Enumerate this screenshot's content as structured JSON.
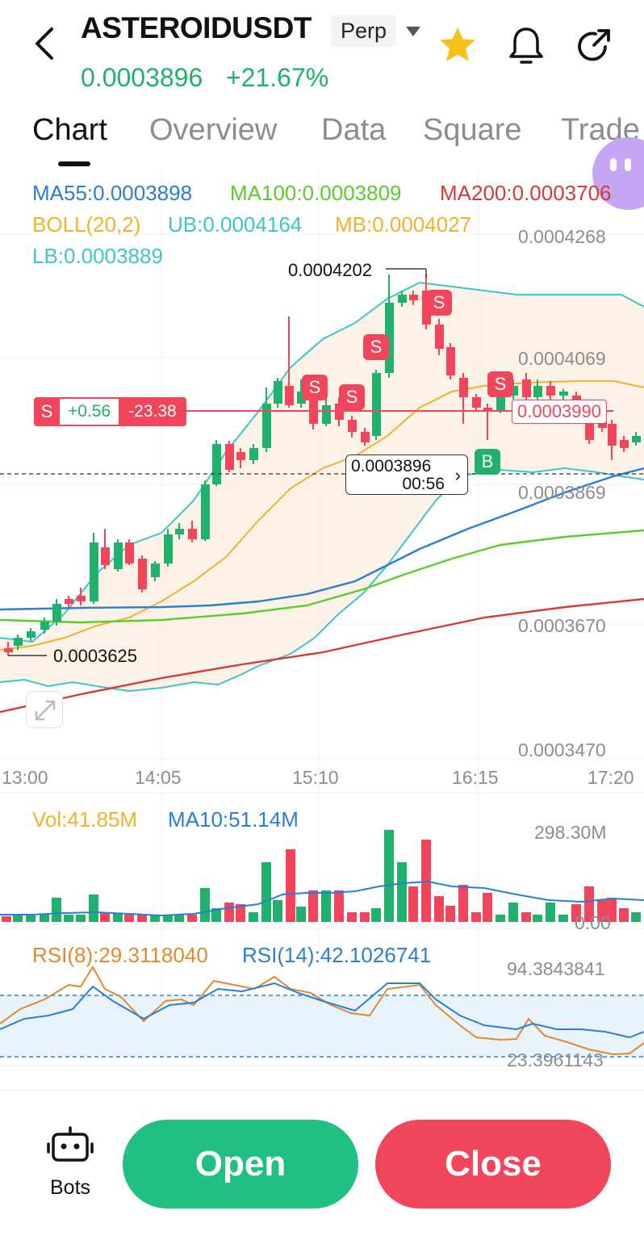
{
  "header": {
    "symbol": "ASTEROIDUSDT",
    "contract_type": "Perp",
    "last_price": "0.0003896",
    "change_pct": "+21.67%",
    "icons": [
      "back-arrow-icon",
      "caret-down-icon",
      "star-icon",
      "bell-icon",
      "share-icon"
    ],
    "favorite": true
  },
  "tabs": [
    "Chart",
    "Overview",
    "Data",
    "Square",
    "Trade"
  ],
  "active_tab": "Chart",
  "indicators": {
    "ma55": "MA55:0.0003898",
    "ma100": "MA100:0.0003809",
    "ma200": "MA200:0.0003706",
    "boll": "BOLL(20,2)",
    "ub": "UB:0.0004164",
    "mb": "MB:0.0004027",
    "lb": "LB:0.0003889"
  },
  "price_axis": [
    "0.0004268",
    "0.0004069",
    "0.0003869",
    "0.0003670",
    "0.0003470"
  ],
  "time_axis": [
    "13:00",
    "14:05",
    "15:10",
    "16:15",
    "17:20"
  ],
  "markers": {
    "high": "0.0004202",
    "low": "0.0003625",
    "sell_label": "S",
    "buy_label": "B"
  },
  "position": {
    "side": "S",
    "qty": "+0.56",
    "pnl": "-23.38",
    "entry_price": "0.0003990"
  },
  "last_price_box": {
    "price": "0.0003896",
    "countdown": "00:56",
    "arrow": "›"
  },
  "volume": {
    "vol": "Vol:41.85M",
    "ma10": "MA10:51.14M",
    "max": "298.30M",
    "min": "0.00"
  },
  "rsi": {
    "rsi8": "RSI(8):29.3118040",
    "rsi14": "RSI(14):42.1026741",
    "max": "94.3843841",
    "min": "23.3961143"
  },
  "colors": {
    "up": "#20b26c",
    "down": "#f0455a",
    "ma55": "#2a7fd4",
    "ma100": "#5ccc2c",
    "ma200": "#d63a36",
    "boll_mb": "#f0b22a",
    "boll_band": "#3cc6cc",
    "rsi8": "#e08a2c",
    "rsi14": "#2a7fd4"
  },
  "bottom": {
    "bots_label": "Bots",
    "open_label": "Open",
    "close_label": "Close"
  }
}
